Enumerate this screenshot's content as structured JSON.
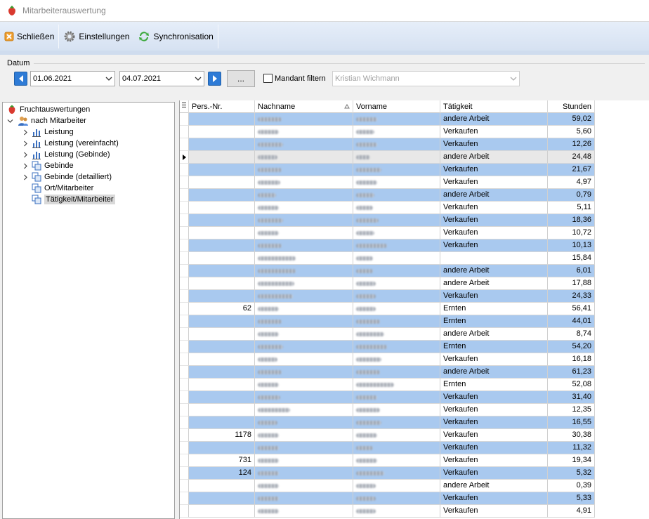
{
  "window": {
    "title": "Mitarbeiterauswertung"
  },
  "toolbar": {
    "close_label": "Schließen",
    "settings_label": "Einstellungen",
    "sync_label": "Synchronisation"
  },
  "filter": {
    "group_label": "Datum",
    "date_from": "01.06.2021",
    "date_to": "04.07.2021",
    "dots_label": "...",
    "mandant_label": "Mandant filtern",
    "mandant_checked": false,
    "mandant_value": "Kristian Wichmann"
  },
  "tree": {
    "root": "Fruchtauswertungen",
    "group": "nach Mitarbeiter",
    "items": [
      "Leistung",
      "Leistung (vereinfacht)",
      "Leistung (Gebinde)",
      "Gebinde",
      "Gebinde (detailliert)",
      "Ort/Mitarbeiter",
      "Tätigkeit/Mitarbeiter"
    ],
    "selected": "Tätigkeit/Mitarbeiter"
  },
  "grid": {
    "columns": [
      "Pers.-Nr.",
      "Nachname",
      "Vorname",
      "Tätigkeit",
      "Stunden"
    ],
    "sort_column": "Nachname",
    "current_row": 3,
    "row_highlight_color": "#a9c9ef",
    "current_row_color": "#e8e8e8",
    "rows": [
      {
        "nr": "",
        "tat": "andere Arbeit",
        "std": "59,02",
        "hl": true
      },
      {
        "nr": "",
        "tat": "Verkaufen",
        "std": "5,60",
        "hl": false
      },
      {
        "nr": "",
        "tat": "Verkaufen",
        "std": "12,26",
        "hl": true
      },
      {
        "nr": "",
        "tat": "andere Arbeit",
        "std": "24,48",
        "hl": false
      },
      {
        "nr": "",
        "tat": "Verkaufen",
        "std": "21,67",
        "hl": true
      },
      {
        "nr": "",
        "tat": "Verkaufen",
        "std": "4,97",
        "hl": false
      },
      {
        "nr": "",
        "tat": "andere Arbeit",
        "std": "0,79",
        "hl": true
      },
      {
        "nr": "",
        "tat": "Verkaufen",
        "std": "5,11",
        "hl": false
      },
      {
        "nr": "",
        "tat": "Verkaufen",
        "std": "18,36",
        "hl": true
      },
      {
        "nr": "",
        "tat": "Verkaufen",
        "std": "10,72",
        "hl": false
      },
      {
        "nr": "",
        "tat": "Verkaufen",
        "std": "10,13",
        "hl": true
      },
      {
        "nr": "",
        "tat": "",
        "std": "15,84",
        "hl": false
      },
      {
        "nr": "",
        "tat": "andere Arbeit",
        "std": "6,01",
        "hl": true
      },
      {
        "nr": "",
        "tat": "andere Arbeit",
        "std": "17,88",
        "hl": false
      },
      {
        "nr": "",
        "tat": "Verkaufen",
        "std": "24,33",
        "hl": true
      },
      {
        "nr": "62",
        "tat": "Ernten",
        "std": "56,41",
        "hl": false
      },
      {
        "nr": "",
        "tat": "Ernten",
        "std": "44,01",
        "hl": true
      },
      {
        "nr": "",
        "tat": "andere Arbeit",
        "std": "8,74",
        "hl": false
      },
      {
        "nr": "",
        "tat": "Ernten",
        "std": "54,20",
        "hl": true
      },
      {
        "nr": "",
        "tat": "Verkaufen",
        "std": "16,18",
        "hl": false
      },
      {
        "nr": "",
        "tat": "andere Arbeit",
        "std": "61,23",
        "hl": true
      },
      {
        "nr": "",
        "tat": "Ernten",
        "std": "52,08",
        "hl": false
      },
      {
        "nr": "",
        "tat": "Verkaufen",
        "std": "31,40",
        "hl": true
      },
      {
        "nr": "",
        "tat": "Verkaufen",
        "std": "12,35",
        "hl": false
      },
      {
        "nr": "",
        "tat": "Verkaufen",
        "std": "16,55",
        "hl": true
      },
      {
        "nr": "1178",
        "tat": "Verkaufen",
        "std": "30,38",
        "hl": false
      },
      {
        "nr": "",
        "tat": "Verkaufen",
        "std": "11,32",
        "hl": true
      },
      {
        "nr": "731",
        "tat": "Verkaufen",
        "std": "19,34",
        "hl": false
      },
      {
        "nr": "124",
        "tat": "Verkaufen",
        "std": "5,32",
        "hl": true
      },
      {
        "nr": "",
        "tat": "andere Arbeit",
        "std": "0,39",
        "hl": false
      },
      {
        "nr": "",
        "tat": "Verkaufen",
        "std": "5,33",
        "hl": true
      },
      {
        "nr": "",
        "tat": "Verkaufen",
        "std": "4,91",
        "hl": false
      }
    ]
  }
}
